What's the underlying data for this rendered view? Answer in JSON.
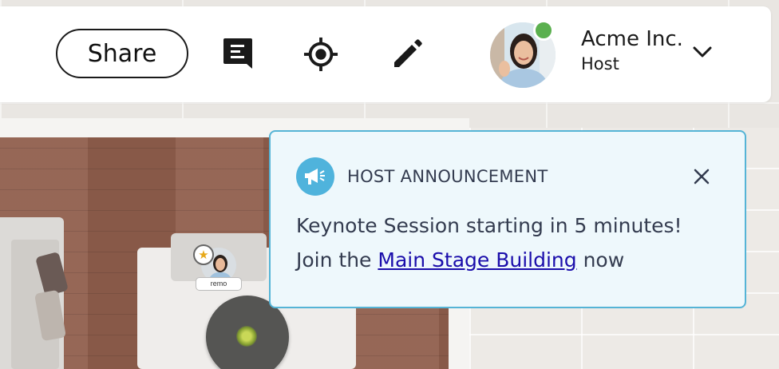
{
  "topbar": {
    "share_label": "Share",
    "icons": [
      "notes-icon",
      "locate-icon",
      "edit-icon"
    ],
    "user": {
      "org_name": "Acme Inc.",
      "role": "Host",
      "status": "online"
    }
  },
  "announcement": {
    "title": "HOST ANNOUNCEMENT",
    "line1": "Keynote Session starting in 5 minutes!",
    "line2_prefix": "Join the",
    "link_text": "Main Stage Building",
    "line2_suffix": "now"
  },
  "scene": {
    "seat_tag": "remo"
  },
  "colors": {
    "accent": "#4fb3dc",
    "announcement_bg": "#eef8fc",
    "announcement_border": "#55b4d6",
    "online": "#5bb04f",
    "link": "#1a0dab"
  }
}
